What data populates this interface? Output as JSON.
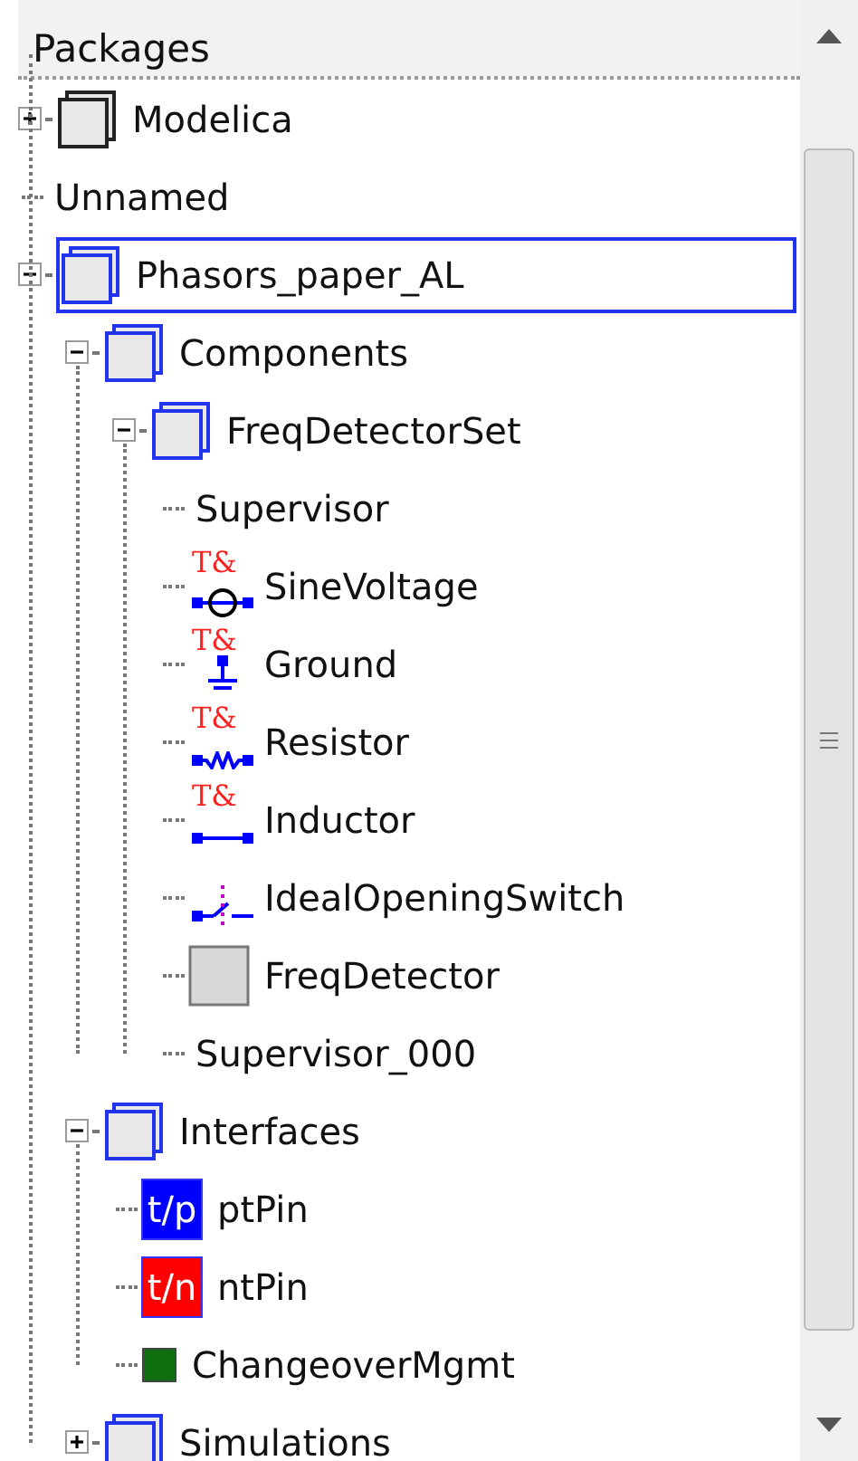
{
  "header": {
    "title": "Packages"
  },
  "tree": [
    {
      "label": "Modelica",
      "kind": "library",
      "expanded": false,
      "selected": false
    },
    {
      "label": "Unnamed",
      "kind": "plain",
      "selected": false
    },
    {
      "label": "Phasors_paper_AL",
      "kind": "package",
      "expanded": true,
      "selected": true,
      "children": [
        {
          "label": "Components",
          "kind": "package",
          "expanded": true,
          "selected": false,
          "children": [
            {
              "label": "FreqDetectorSet",
              "kind": "package",
              "expanded": true,
              "selected": false,
              "children": [
                {
                  "label": "Supervisor",
                  "kind": "plain",
                  "selected": false
                },
                {
                  "label": "SineVoltage",
                  "kind": "source",
                  "badge": "T&",
                  "selected": false
                },
                {
                  "label": "Ground",
                  "kind": "ground",
                  "badge": "T&",
                  "selected": false
                },
                {
                  "label": "Resistor",
                  "kind": "resistor",
                  "badge": "T&",
                  "selected": false
                },
                {
                  "label": "Inductor",
                  "kind": "inductor",
                  "badge": "T&",
                  "selected": false
                },
                {
                  "label": "IdealOpeningSwitch",
                  "kind": "switch",
                  "selected": false
                },
                {
                  "label": "FreqDetector",
                  "kind": "block",
                  "selected": false
                },
                {
                  "label": "Supervisor_000",
                  "kind": "plain",
                  "selected": false
                }
              ]
            }
          ]
        },
        {
          "label": "Interfaces",
          "kind": "package",
          "expanded": true,
          "selected": false,
          "children": [
            {
              "label": "ptPin",
              "kind": "pin",
              "icon_text": "t/p",
              "color": "#0000ff",
              "selected": false
            },
            {
              "label": "ntPin",
              "kind": "pin",
              "icon_text": "t/n",
              "color": "#ff0000",
              "selected": false
            },
            {
              "label": "ChangeoverMgmt",
              "kind": "state",
              "color": "#107010",
              "selected": false
            }
          ]
        },
        {
          "label": "Simulations",
          "kind": "package",
          "expanded": false,
          "selected": false
        }
      ]
    }
  ]
}
